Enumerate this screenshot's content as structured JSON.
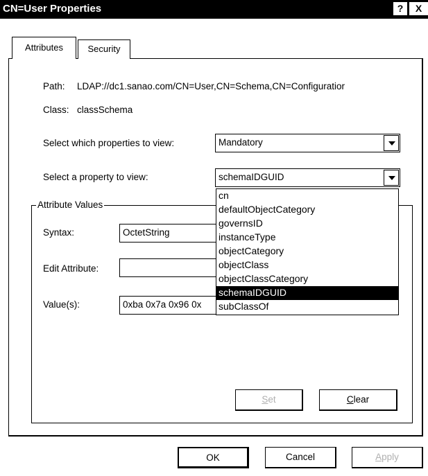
{
  "window": {
    "title": "CN=User Properties",
    "help_label": "?",
    "close_label": "X"
  },
  "tabs": [
    {
      "label": "Attributes",
      "selected": true
    },
    {
      "label": "Security",
      "selected": false
    }
  ],
  "path": {
    "label": "Path:",
    "value": "LDAP://dc1.sanao.com/CN=User,CN=Schema,CN=Configuratior"
  },
  "class": {
    "label": "Class:",
    "value": "classSchema"
  },
  "view_select": {
    "label": "Select which properties to view:",
    "value": "Mandatory"
  },
  "property_select": {
    "label": "Select a property to view:",
    "value": "schemaIDGUID",
    "options": [
      "cn",
      "defaultObjectCategory",
      "governsID",
      "instanceType",
      "objectCategory",
      "objectClass",
      "objectClassCategory",
      "schemaIDGUID",
      "subClassOf"
    ],
    "selected_index": 7
  },
  "attribute_values": {
    "group_label": "Attribute Values",
    "syntax_label": "Syntax:",
    "syntax_value": "OctetString",
    "edit_label": "Edit Attribute:",
    "edit_value": "",
    "values_label": "Value(s):",
    "values_value": "0xba 0x7a 0x96 0x"
  },
  "buttons": {
    "set_mnemonic": "S",
    "set_rest": "et",
    "clear_mnemonic": "C",
    "clear_rest": "lear",
    "ok": "OK",
    "cancel": "Cancel",
    "apply_mnemonic": "A",
    "apply_rest": "pply"
  }
}
